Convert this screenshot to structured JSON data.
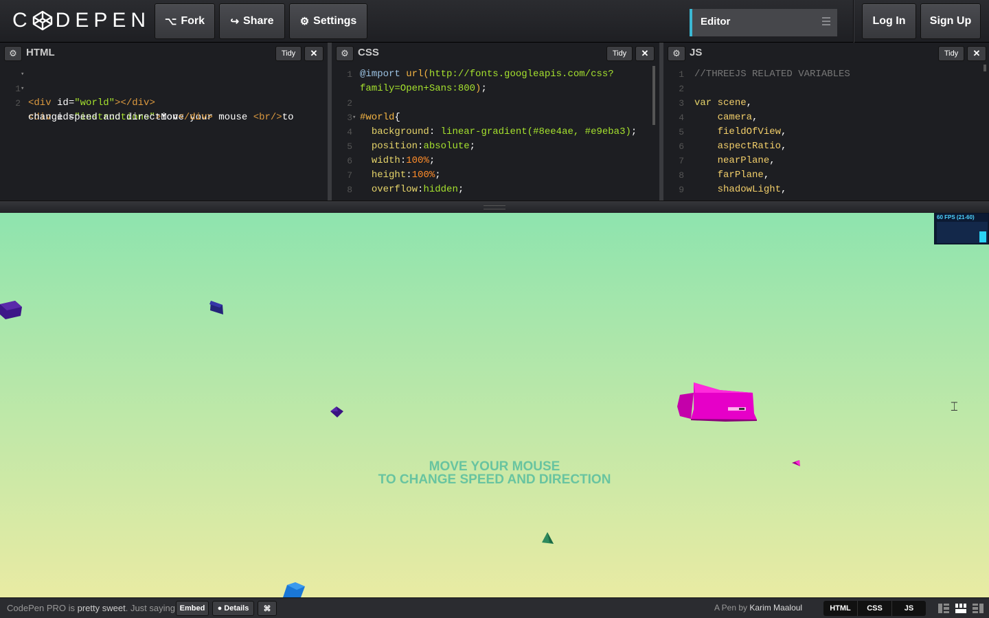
{
  "topbar": {
    "logo_text": "CODEPEN",
    "fork_label": "Fork",
    "share_label": "Share",
    "settings_label": "Settings",
    "editor_view_label": "Editor",
    "login_label": "Log In",
    "signup_label": "Sign Up",
    "accent_color": "#3bb8d3"
  },
  "panes": {
    "html": {
      "title": "HTML",
      "tidy_label": "Tidy",
      "lines": [
        {
          "n": "1",
          "text": "<div id=\"world\"></div>"
        },
        {
          "n": "2",
          "text": "<div id=\"instructions\">Move your mouse <br/>to"
        },
        {
          "n": "",
          "text": "change speed and direction</div>"
        }
      ]
    },
    "css": {
      "title": "CSS",
      "tidy_label": "Tidy",
      "lines": [
        {
          "n": "1",
          "text": "@import url(http://fonts.googleapis.com/css?"
        },
        {
          "n": "",
          "text": "family=Open+Sans:800);"
        },
        {
          "n": "2",
          "text": ""
        },
        {
          "n": "3",
          "text": "#world{"
        },
        {
          "n": "4",
          "text": "  background: linear-gradient(#8ee4ae, #e9eba3);"
        },
        {
          "n": "5",
          "text": "  position:absolute;"
        },
        {
          "n": "6",
          "text": "  width:100%;"
        },
        {
          "n": "7",
          "text": "  height:100%;"
        },
        {
          "n": "8",
          "text": "  overflow:hidden;"
        }
      ]
    },
    "js": {
      "title": "JS",
      "tidy_label": "Tidy",
      "lines": [
        {
          "n": "1",
          "text": "//THREEJS RELATED VARIABLES"
        },
        {
          "n": "2",
          "text": ""
        },
        {
          "n": "3",
          "text": "var scene,"
        },
        {
          "n": "4",
          "text": "    camera,"
        },
        {
          "n": "5",
          "text": "    fieldOfView,"
        },
        {
          "n": "6",
          "text": "    aspectRatio,"
        },
        {
          "n": "7",
          "text": "    nearPlane,"
        },
        {
          "n": "8",
          "text": "    farPlane,"
        },
        {
          "n": "9",
          "text": "    shadowLight,"
        }
      ]
    }
  },
  "preview": {
    "instruction_line1": "MOVE YOUR MOUSE",
    "instruction_line2": "TO CHANGE SPEED AND DIRECTION",
    "fps_label": "60 FPS (21-60)",
    "background_from": "#8ee4ae",
    "background_to": "#e9eba3",
    "character_color": "#ee00cc"
  },
  "footer": {
    "promo_prefix": "CodePen PRO is",
    "promo_bold": "pretty sweet",
    "promo_suffix": ". Just saying.",
    "embed_label": "Embed",
    "details_label": "Details",
    "byline_prefix": "A Pen by",
    "author": "Karim Maaloul",
    "view_html": "HTML",
    "view_css": "CSS",
    "view_js": "JS"
  }
}
